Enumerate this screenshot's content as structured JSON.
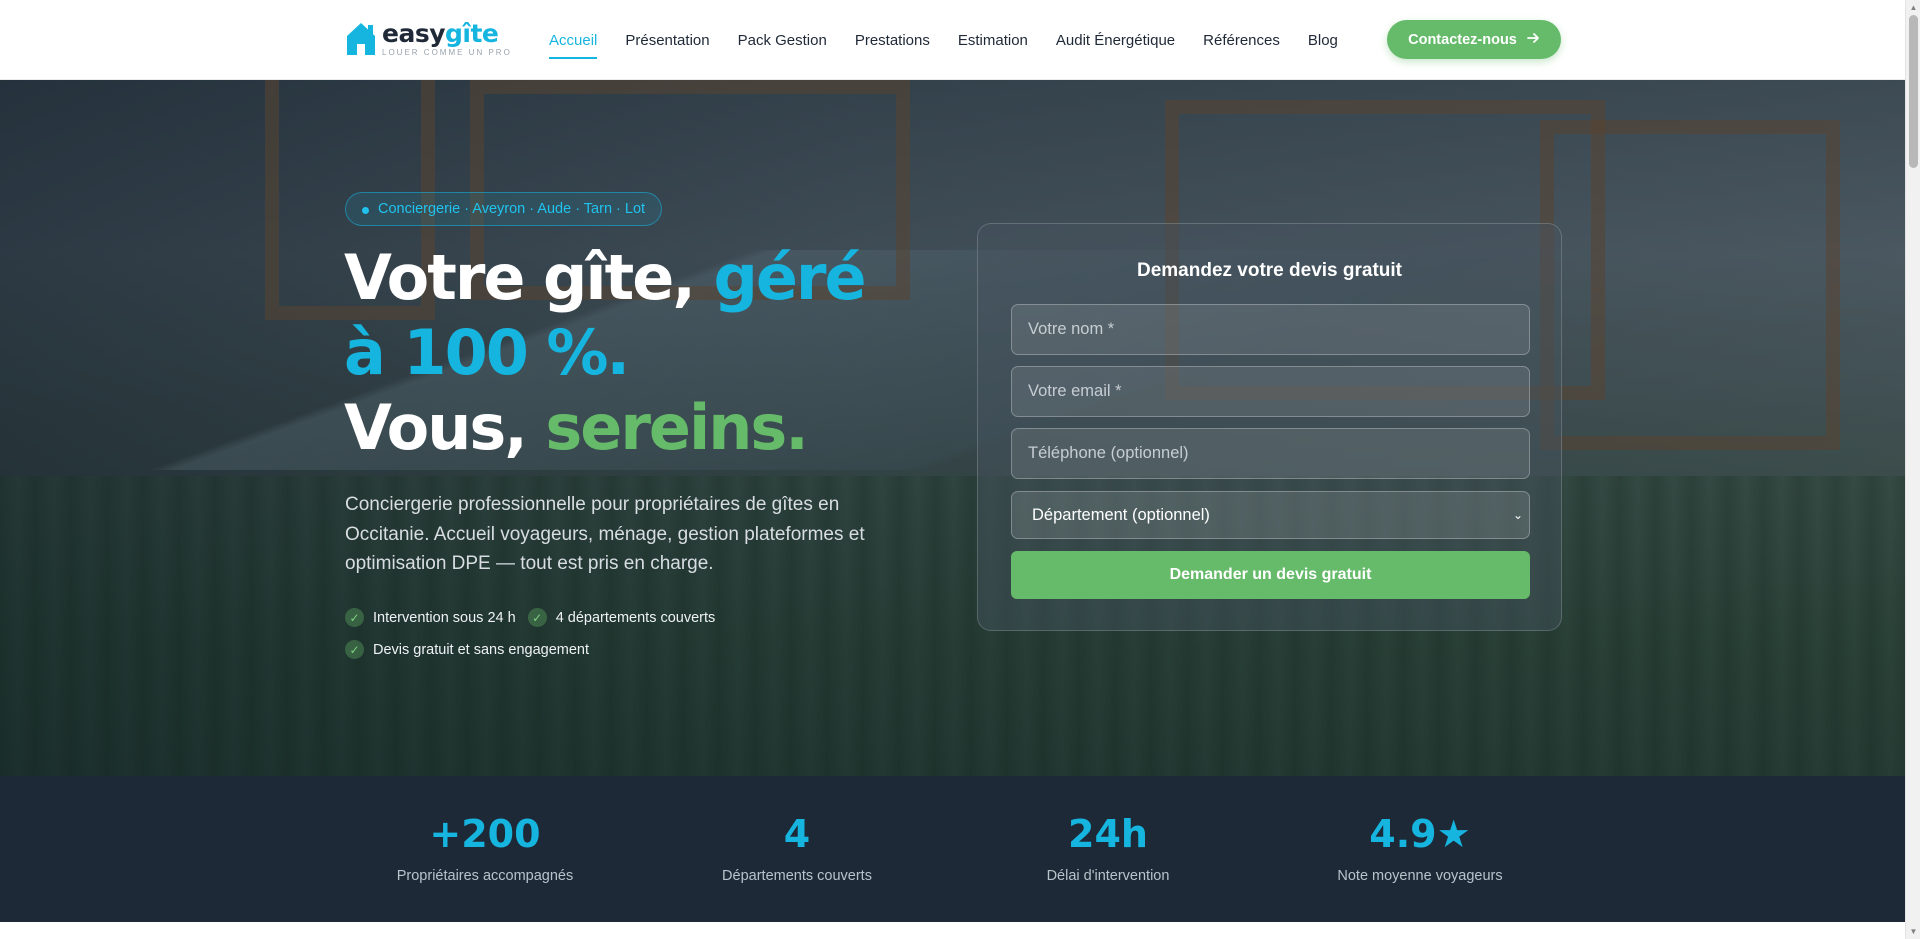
{
  "header": {
    "logo": {
      "brand_first": "easy",
      "brand_second": "gîte",
      "tagline": "LOUER COMME UN PRO"
    },
    "nav": [
      {
        "label": "Accueil",
        "active": true
      },
      {
        "label": "Présentation",
        "active": false
      },
      {
        "label": "Pack Gestion",
        "active": false
      },
      {
        "label": "Prestations",
        "active": false
      },
      {
        "label": "Estimation",
        "active": false
      },
      {
        "label": "Audit Énergétique",
        "active": false
      },
      {
        "label": "Références",
        "active": false
      },
      {
        "label": "Blog",
        "active": false
      }
    ],
    "cta_label": "Contactez-nous",
    "cta_icon": "arrow-right-icon"
  },
  "hero": {
    "badge": "Conciergerie · Aveyron · Aude · Tarn · Lot",
    "headline": {
      "part1": "Votre gîte, ",
      "part2": "géré à 100 %.",
      "part3": "Vous, ",
      "part4": "sereins."
    },
    "lead": "Conciergerie professionnelle pour propriétaires de gîtes en Occitanie. Accueil voyageurs, ménage, gestion plateformes et optimisation DPE — tout est pris en charge.",
    "checks": [
      "Intervention sous 24 h",
      "4 départements couverts",
      "Devis gratuit et sans engagement"
    ]
  },
  "form": {
    "title": "Demandez votre devis gratuit",
    "name_placeholder": "Votre nom *",
    "email_placeholder": "Votre email *",
    "phone_placeholder": "Téléphone (optionnel)",
    "department_selected": "Département (optionnel)",
    "submit_label": "Demander un devis gratuit"
  },
  "stats": [
    {
      "value": "+200",
      "label": "Propriétaires accompagnés"
    },
    {
      "value": "4",
      "label": "Départements couverts"
    },
    {
      "value": "24h",
      "label": "Délai d'intervention"
    },
    {
      "value": "4.9★",
      "label": "Note moyenne voyageurs"
    }
  ],
  "colors": {
    "brand_blue": "#16b5e0",
    "brand_green": "#66bb6a",
    "stats_bg": "#1d2937",
    "text_dark": "#1f2937"
  }
}
